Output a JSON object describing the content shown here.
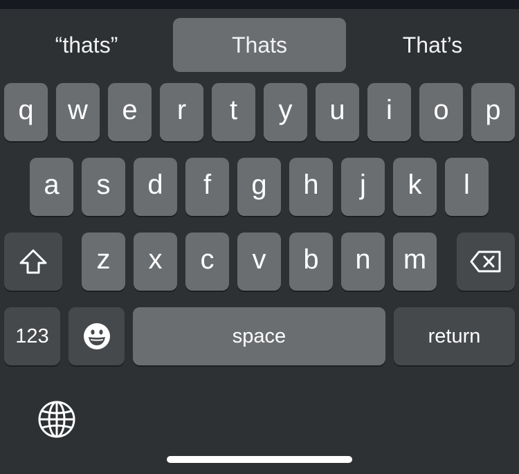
{
  "suggestions": [
    {
      "label": "“thats”",
      "selected": false
    },
    {
      "label": "Thats",
      "selected": true
    },
    {
      "label": "That’s",
      "selected": false
    }
  ],
  "keyboard": {
    "row1": [
      "q",
      "w",
      "e",
      "r",
      "t",
      "y",
      "u",
      "i",
      "o",
      "p"
    ],
    "row2": [
      "a",
      "s",
      "d",
      "f",
      "g",
      "h",
      "j",
      "k",
      "l"
    ],
    "row3": [
      "z",
      "x",
      "c",
      "v",
      "b",
      "n",
      "m"
    ],
    "numbers_label": "123",
    "space_label": "space",
    "return_label": "return"
  },
  "icons": {
    "shift": "shift-icon",
    "delete": "delete-icon",
    "emoji": "emoji-icon",
    "globe": "globe-icon"
  },
  "colors": {
    "background": "#2e3134",
    "letter_key": "#6b6e71",
    "function_key": "#46494c",
    "text": "#ffffff"
  }
}
